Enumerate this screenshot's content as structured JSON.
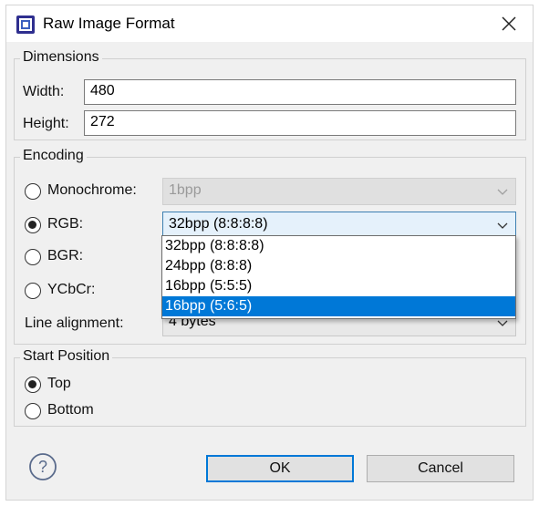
{
  "window": {
    "title": "Raw Image Format"
  },
  "dimensions": {
    "legend": "Dimensions",
    "width_label": "Width:",
    "width_value": "480",
    "height_label": "Height:",
    "height_value": "272"
  },
  "encoding": {
    "legend": "Encoding",
    "monochrome": {
      "label": "Monochrome:",
      "value": "1bpp",
      "checked": false,
      "enabled": false
    },
    "rgb": {
      "label": "RGB:",
      "value": "32bpp (8:8:8:8)",
      "checked": true
    },
    "bgr": {
      "label": "BGR:",
      "checked": false
    },
    "ycbcr": {
      "label": "YCbCr:",
      "checked": false
    },
    "line_alignment": {
      "label": "Line alignment:",
      "value": "4 bytes"
    },
    "rgb_dropdown_options": [
      "32bpp (8:8:8:8)",
      "24bpp (8:8:8)",
      "16bpp (5:5:5)",
      "16bpp (5:6:5)"
    ],
    "highlighted_option_index": 3
  },
  "start_position": {
    "legend": "Start Position",
    "top_label": "Top",
    "bottom_label": "Bottom",
    "selected": "Top"
  },
  "buttons": {
    "ok": "OK",
    "cancel": "Cancel"
  },
  "icons": {
    "app": "app-icon",
    "close": "close-icon",
    "help": "help-icon",
    "chevron": "chevron-down-icon"
  },
  "colors": {
    "selection": "#0078d7",
    "active_combo_bg": "#e5f1fb",
    "dialog_bg": "#f0f0f0"
  }
}
